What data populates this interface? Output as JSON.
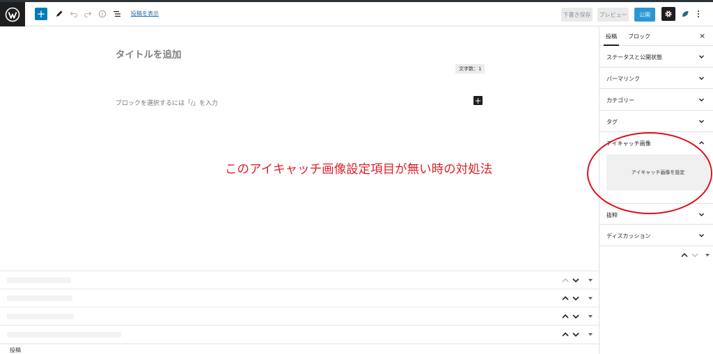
{
  "header": {
    "view_post": "投稿を表示",
    "draft": "下書き保存",
    "preview": "プレビュー",
    "publish": "公開"
  },
  "editor": {
    "title_placeholder": "タイトルを追加",
    "word_count": "文字数：1",
    "block_placeholder": "ブロックを選択するには「/」を入力",
    "annotation": "このアイキャッチ画像設定項目が無い時の対処法"
  },
  "sidebar": {
    "tabs": [
      "投稿",
      "ブロック"
    ],
    "close": "×",
    "panels": [
      "ステータスと公開状態",
      "パーマリンク",
      "カテゴリー",
      "タグ",
      "アイキャッチ画像",
      "抜粋",
      "ディスカッション"
    ],
    "featured_image_button": "アイキャッチ画像を設定"
  },
  "footer": {
    "breadcrumb": "投稿"
  },
  "colors": {
    "accent": "#007cba",
    "publish": "#2c96d3",
    "annotation": "#e0202a"
  },
  "icons": [
    "wordpress-logo-icon",
    "plus-icon",
    "pencil-icon",
    "undo-icon",
    "redo-icon",
    "info-icon",
    "list-view-icon",
    "gear-icon",
    "leaf-icon",
    "more-vertical-icon",
    "chevron-down-icon",
    "chevron-up-icon",
    "close-icon"
  ]
}
